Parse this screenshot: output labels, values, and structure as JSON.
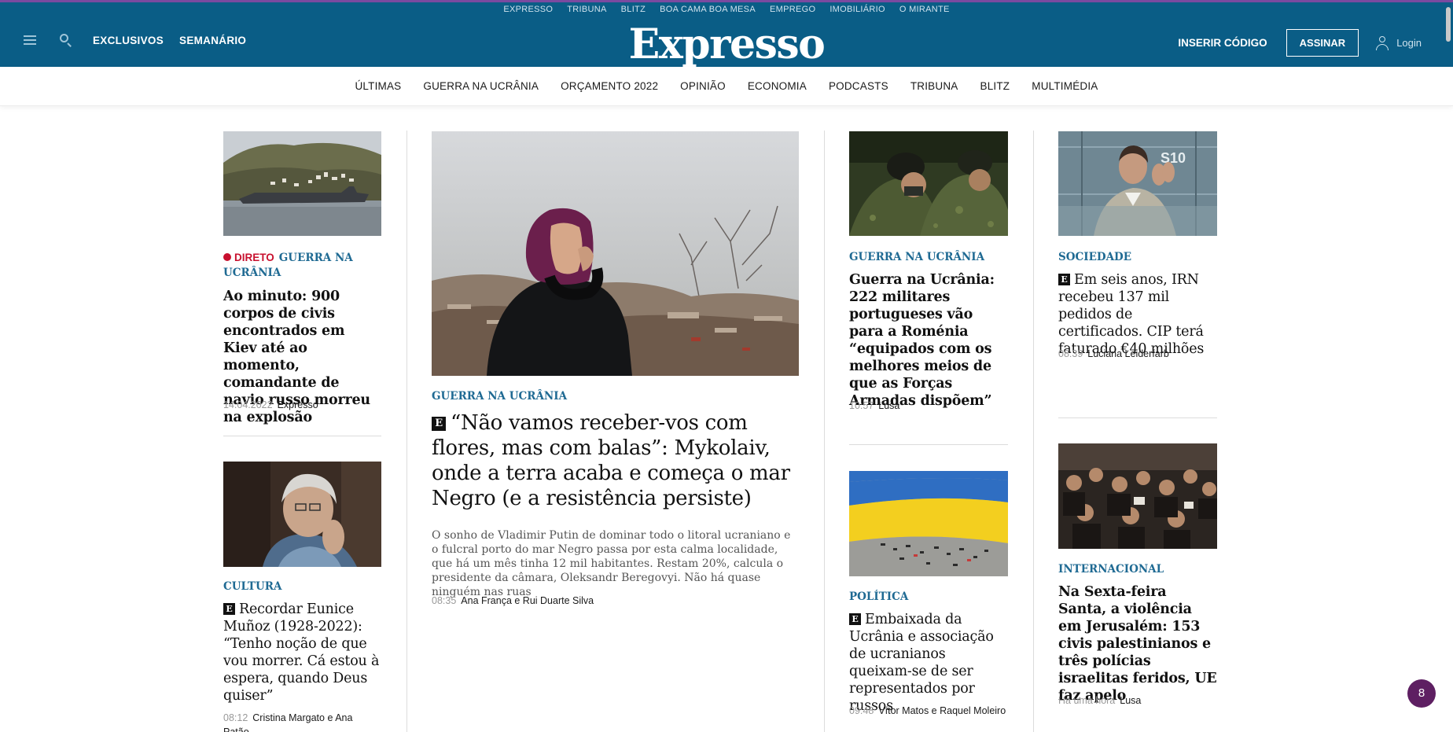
{
  "header": {
    "sites": [
      "EXPRESSO",
      "TRIBUNA",
      "BLITZ",
      "BOA CAMA BOA MESA",
      "EMPREGO",
      "IMOBILIÁRIO",
      "O MIRANTE"
    ],
    "logo": "Expresso",
    "left_links": [
      "EXCLUSIVOS",
      "SEMANÁRIO"
    ],
    "inserir_codigo": "INSERIR CÓDIGO",
    "assinar": "ASSINAR",
    "login": "Login",
    "colors": {
      "bar": "#0a5d86",
      "accent_line": "#7a4aa0"
    }
  },
  "nav": {
    "items": [
      "ÚLTIMAS",
      "GUERRA NA UCRÂNIA",
      "ORÇAMENTO 2022",
      "OPINIÃO",
      "ECONOMIA",
      "PODCASTS",
      "TRIBUNA",
      "BLITZ",
      "MULTIMÉDIA"
    ]
  },
  "articles": {
    "a1": {
      "image": "warship-coast-photo",
      "live_label": "DIRETO",
      "kicker": "GUERRA NA UCRÂNIA",
      "headline": "Ao minuto: 900 corpos de civis encontrados em Kiev até ao momento, comandante de navio russo morreu na explosão",
      "time": "14.04.2022",
      "author": "Expresso"
    },
    "a2": {
      "image": "elderly-woman-portrait-photo",
      "kicker": "CULTURA",
      "exclusive_badge": "E",
      "headline": "Recordar Eunice Muñoz (1928-2022): “Tenho noção de que vou morrer. Cá estou à espera, quando Deus quiser”",
      "time": "08:12",
      "author": "Cristina Margato e Ana Patão"
    },
    "main": {
      "image": "woman-crying-ruins-photo",
      "kicker": "GUERRA NA UCRÂNIA",
      "exclusive_badge": "E",
      "headline": "“Não vamos receber-vos com flores, mas com balas”: Mykolaiv, onde a terra acaba e começa o mar Negro (e a resistência persiste)",
      "lead": "O sonho de Vladimir Putin de dominar todo o litoral ucraniano e o fulcral porto do mar Negro passa por esta calma localidade, que há um mês tinha 12 mil habitantes. Restam 20%, calcula o presidente da câmara, Oleksandr Beregovyi. Não há quase ninguém nas ruas",
      "time": "08:35",
      "author": "Ana França e Rui Duarte Silva"
    },
    "a3": {
      "image": "soldiers-photo",
      "kicker": "GUERRA NA UCRÂNIA",
      "headline": "Guerra na Ucrânia: 222 militares portugueses vão para a Roménia “equipados com os melhores meios de que as Forças Armadas dispõem”",
      "time": "10:57",
      "author": "Lusa"
    },
    "a4": {
      "image": "ukraine-flag-shoes-photo",
      "kicker": "POLÍTICA",
      "exclusive_badge": "E",
      "headline": "Embaixada da Ucrânia e associação de ucranianos queixam-se de ser representados por russos",
      "time": "09:48",
      "author": "Vítor Matos e Raquel Moleiro"
    },
    "a5": {
      "image": "man-applauding-stadium-photo",
      "kicker": "SOCIEDADE",
      "exclusive_badge": "E",
      "headline": "Em seis anos, IRN recebeu 137 mil pedidos de certificados. CIP terá faturado €40 milhões",
      "time": "08:39",
      "author": "Luciana Leiderfarb"
    },
    "a6": {
      "image": "jerusalem-crowd-photo",
      "kicker": "INTERNACIONAL",
      "headline": "Na Sexta-feira Santa, a violência em Jerusalém: 153 civis palestinianos e três polícias israelitas feridos, UE faz apelo",
      "time": "Há uma hora",
      "author": "Lusa"
    }
  },
  "notification_count": "8"
}
